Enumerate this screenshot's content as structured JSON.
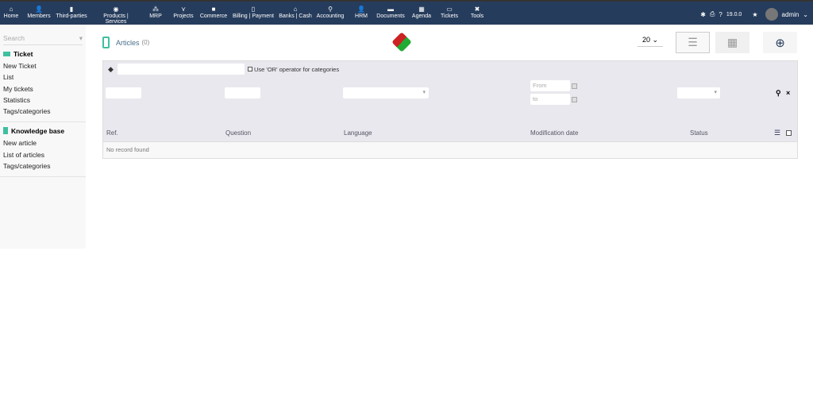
{
  "topbar": {
    "items": [
      {
        "label": "Home",
        "icon": "⌂"
      },
      {
        "label": "Members",
        "icon": "👤"
      },
      {
        "label": "Third-parties",
        "icon": "▮"
      },
      {
        "label": "Products | Services",
        "icon": "◉"
      },
      {
        "label": "MRP",
        "icon": "⁂"
      },
      {
        "label": "Projects",
        "icon": "⋎"
      },
      {
        "label": "Commerce",
        "icon": "■"
      },
      {
        "label": "Billing | Payment",
        "icon": "▯"
      },
      {
        "label": "Banks | Cash",
        "icon": "⌂"
      },
      {
        "label": "Accounting",
        "icon": "⚲"
      },
      {
        "label": "HRM",
        "icon": "👤"
      },
      {
        "label": "Documents",
        "icon": "▬"
      },
      {
        "label": "Agenda",
        "icon": "▦"
      },
      {
        "label": "Tickets",
        "icon": "▭"
      },
      {
        "label": "Tools",
        "icon": "✖"
      }
    ],
    "active": "Tickets",
    "version": "19.0.0",
    "user": "admin"
  },
  "sidebar": {
    "search_placeholder": "Search",
    "sections": [
      {
        "title": "Ticket",
        "items": [
          "New Ticket",
          "List",
          "My tickets",
          "Statistics",
          "Tags/categories"
        ]
      },
      {
        "title": "Knowledge base",
        "items": [
          "New article",
          "List of articles",
          "Tags/categories"
        ]
      }
    ]
  },
  "main": {
    "title": "Articles",
    "count": "(0)",
    "limit": "20",
    "or_label": "Use 'OR' operator for categories",
    "from_placeholder": "From",
    "to_placeholder": "to",
    "columns": [
      "Ref.",
      "Question",
      "Language",
      "Modification date",
      "Status"
    ],
    "empty": "No record found"
  }
}
